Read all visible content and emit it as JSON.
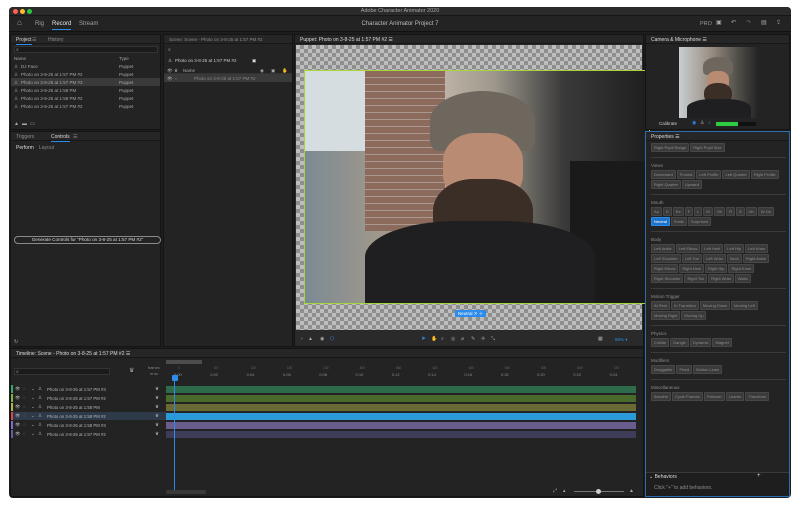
{
  "window": {
    "title": "Adobe Character Animator 2020"
  },
  "topbar": {
    "modes": [
      "Rig",
      "Record",
      "Stream"
    ],
    "active_mode": "Record",
    "project_title": "Character Animator Project 7",
    "pro_label": "PRO"
  },
  "project_panel": {
    "tabs": [
      "Project",
      "History"
    ],
    "col_name": "Name",
    "col_type": "Type",
    "items": [
      {
        "name": "DJ Face",
        "type": "Puppet"
      },
      {
        "name": "Photo on 3-8-25 at 1:57 PM #2",
        "type": "Puppet"
      },
      {
        "name": "Photo on 3-8-25 at 1:57 PM #3",
        "type": "Puppet"
      },
      {
        "name": "Photo on 3-8-25 at 1:58 PM",
        "type": "Puppet"
      },
      {
        "name": "Photo on 3-8-25 at 1:58 PM #2",
        "type": "Puppet"
      },
      {
        "name": "Photo on 3-8-25 at 1:57 PM #2",
        "type": "Puppet"
      }
    ]
  },
  "controls_panel": {
    "tabs": [
      "Triggers",
      "Controls"
    ],
    "subtabs": [
      "Perform",
      "Layout"
    ],
    "generate_button": "Generate Controls for \"Photo on 3-8-25 at 1:57 PM #2\""
  },
  "scene_panel": {
    "tab": "Scene: Scene - Photo on 3-8-25 at 1:57 PM #2",
    "puppet_title": "Photo on 3-8-25 at 1:57 PM #2",
    "name_col": "Name",
    "child": "Photo on 3-8-25 at 1:57 PM #2"
  },
  "viewer": {
    "tab": "Puppet: Photo on 3-8-25 at 1:57 PM #2",
    "badge": "Neutral",
    "zoom": "86%"
  },
  "camera": {
    "title": "Camera & Microphone",
    "calibrate": "Calibrate",
    "mic_level": 0.55
  },
  "properties": {
    "title": "Properties",
    "top_buttons": [
      "Right Pupil Range",
      "Right Pupil Size"
    ],
    "sections": [
      {
        "name": "Views",
        "items": [
          "Downward",
          "Frontal",
          "Left Profile",
          "Left Quarter",
          "Right Profile",
          "Right Quarter",
          "Upward"
        ]
      },
      {
        "name": "Mouth",
        "items": [
          "Aa",
          "D",
          "Ee",
          "F",
          "L",
          "M",
          "Oh",
          "R",
          "S",
          "Uh",
          "W-Oo",
          "Neutral",
          "Smile",
          "Surprised"
        ]
      },
      {
        "name": "Body",
        "items": [
          "Left Ankle",
          "Left Elbow",
          "Left Heel",
          "Left Hip",
          "Left Knee",
          "Left Shoulder",
          "Left Toe",
          "Left Wrist",
          "Neck",
          "Right Ankle",
          "Right Elbow",
          "Right Heel",
          "Right Hip",
          "Right Knee",
          "Right Shoulder",
          "Right Toe",
          "Right Wrist",
          "Waist"
        ]
      },
      {
        "name": "Motion Trigger",
        "items": [
          "At Rest",
          "In Transition",
          "Moving Down",
          "Moving Left",
          "Moving Right",
          "Moving Up"
        ]
      },
      {
        "name": "Physics",
        "items": [
          "Collide",
          "Dangle",
          "Dynamic",
          "Magnet"
        ]
      },
      {
        "name": "Modifiers",
        "items": [
          "Draggable",
          "Fixed",
          "Motion Lines"
        ]
      },
      {
        "name": "Miscellaneous",
        "items": [
          "Breathe",
          "Cycle Frames",
          "Follower",
          "Leader",
          "Transform"
        ]
      }
    ],
    "highlighted": "Neutral",
    "behaviors_title": "Behaviors",
    "behaviors_hint": "Click \"+\" to add behaviors."
  },
  "timeline": {
    "title": "Timeline: Scene - Photo on 3-8-25 at 1:57 PM #2",
    "frames_label": "frames",
    "frames_value": "m:ss",
    "ticks": [
      "0:00",
      "0:02",
      "0:04",
      "0:06",
      "0:08",
      "0:10",
      "0:12",
      "0:14",
      "0:16",
      "0:18",
      "0:20",
      "0:22",
      "0:24"
    ],
    "frame_ticks": [
      "0",
      "60",
      "120",
      "180",
      "240",
      "300",
      "360",
      "420",
      "480",
      "540",
      "600",
      "660",
      "720"
    ],
    "tracks": [
      {
        "name": "Photo on 3-8-25 at 1:57 PM #3",
        "color": "#2e6b4a",
        "swatch": "#39a66a"
      },
      {
        "name": "Photo on 3-8-25 at 1:57 PM #2",
        "color": "#4a6a2c",
        "swatch": "#7fb53a"
      },
      {
        "name": "Photo on 3-8-25 at 1:58 PM",
        "color": "#6a6a35",
        "swatch": "#b3b34a"
      },
      {
        "name": "Photo on 3-8-25 at 1:58 PM #2",
        "color": "#2a9ad8",
        "swatch": "#d44a4a"
      },
      {
        "name": "Photo on 3-8-25 at 1:58 PM #3",
        "color": "#6b5c8e",
        "swatch": "#8a6ac8"
      },
      {
        "name": "Photo on 3-8-25 at 1:57 PM #2",
        "color": "#3d3d5a",
        "swatch": "#6060a0"
      }
    ]
  }
}
